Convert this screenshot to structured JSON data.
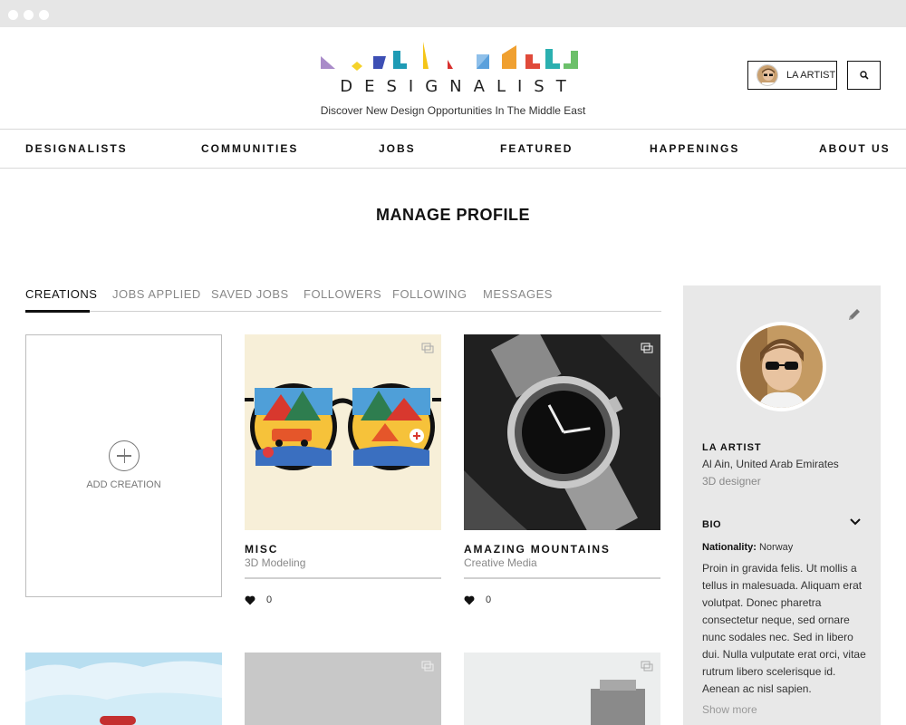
{
  "brand": {
    "wordmark": "DESIGNALIST",
    "tagline": "Discover New Design Opportunities In The Middle East",
    "logo_colors": [
      "#a98bc9",
      "#f5d22a",
      "#3d4fb4",
      "#1f9bb5",
      "#f5c518",
      "#d8312f",
      "#5aa0dc",
      "#f0a030",
      "#e04a3a",
      "#2bb0b0",
      "#6cc06a"
    ]
  },
  "header": {
    "user_label": "LA ARTIST"
  },
  "nav": [
    "DESIGNALISTS",
    "COMMUNITIES",
    "JOBS",
    "FEATURED",
    "HAPPENINGS",
    "ABOUT US"
  ],
  "page_title": "MANAGE PROFILE",
  "tabs": [
    {
      "label": "CREATIONS",
      "active": true
    },
    {
      "label": "JOBS APPLIED",
      "active": false
    },
    {
      "label": "SAVED JOBS",
      "active": false
    },
    {
      "label": "FOLLOWERS",
      "active": false
    },
    {
      "label": "FOLLOWING",
      "active": false
    },
    {
      "label": "MESSAGES",
      "active": false
    }
  ],
  "add_creation_label": "ADD CREATION",
  "creations": [
    {
      "title": "MISC",
      "category": "3D Modeling",
      "likes": "0"
    },
    {
      "title": "AMAZING MOUNTAINS",
      "category": "Creative Media",
      "likes": "0"
    }
  ],
  "profile": {
    "name": "LA ARTIST",
    "location": "Al Ain, United Arab Emirates",
    "role": "3D designer",
    "bio_heading": "BIO",
    "nationality_label": "Nationality:",
    "nationality_value": "Norway",
    "bio_text": "Proin in gravida felis. Ut mollis a tellus in malesuada. Aliquam erat volutpat. Donec pharetra consectetur neque, sed ornare nunc sodales nec. Sed in libero dui. Nulla vulputate erat orci, vitae rutrum libero scelerisque id. Aenean ac nisl sapien.",
    "show_more": "Show more"
  }
}
